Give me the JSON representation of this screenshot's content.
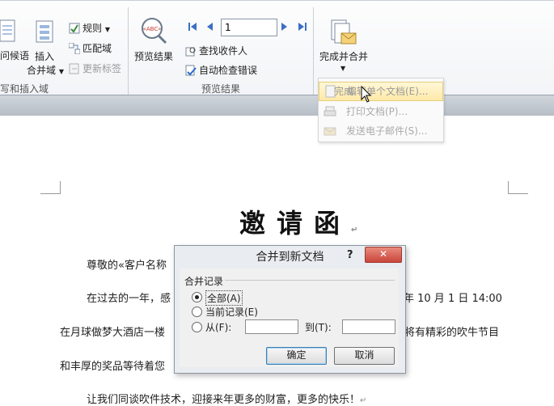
{
  "ribbon": {
    "left_clip": {
      "greeting_label": "问候语",
      "write_insert_label": "写和插入域"
    },
    "insert_merge": {
      "top": "插入",
      "bottom": "合并域"
    },
    "rules_label": "规则",
    "match_fields_label": "匹配域",
    "update_labels_label": "更新标签",
    "preview_results_label": "预览结果",
    "preview_icon_text": "«ABC»",
    "record_number": "1",
    "find_recipient_label": "查找收件人",
    "auto_check_errors_label": "自动检查错误",
    "preview_group_label": "预览结果",
    "finish_merge_label": "完成并合并"
  },
  "finish_menu": {
    "items": [
      {
        "label": "编辑单个文档(E)..."
      },
      {
        "label": "打印文档(P)..."
      },
      {
        "label": "发送电子邮件(S)..."
      }
    ],
    "partial_overlay": "完成"
  },
  "document": {
    "title": "邀请函",
    "salutation": "尊敬的«客户名称",
    "line1_left": "在过去的一年，感",
    "line1_right": "年 10 月 1 日 14:00",
    "line2_left": "在月球做梦大酒店一楼",
    "line2_right": "将有精彩的吹牛节目",
    "line3_left": "和丰厚的奖品等待着您",
    "closing": "让我们同谈吹件技术，迎接来年更多的财富，更多的快乐！",
    "para_mark": "↵"
  },
  "dialog": {
    "title": "合并到新文档",
    "help": "?",
    "close": "✕",
    "group_label": "合并记录",
    "option_all": "全部(A)",
    "option_current": "当前记录(E)",
    "option_from": "从(F):",
    "to_label": "到(T):",
    "from_value": "",
    "to_value": "",
    "ok": "确定",
    "cancel": "取消"
  }
}
